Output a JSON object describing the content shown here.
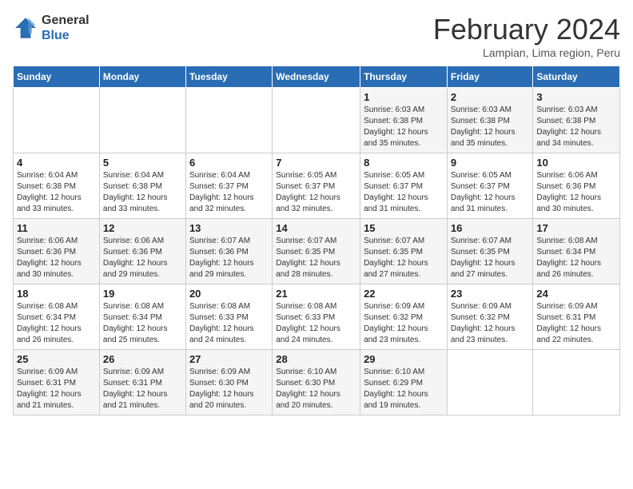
{
  "logo": {
    "line1": "General",
    "line2": "Blue"
  },
  "title": "February 2024",
  "subtitle": "Lampian, Lima region, Peru",
  "days_of_week": [
    "Sunday",
    "Monday",
    "Tuesday",
    "Wednesday",
    "Thursday",
    "Friday",
    "Saturday"
  ],
  "weeks": [
    [
      {
        "day": "",
        "detail": ""
      },
      {
        "day": "",
        "detail": ""
      },
      {
        "day": "",
        "detail": ""
      },
      {
        "day": "",
        "detail": ""
      },
      {
        "day": "1",
        "detail": "Sunrise: 6:03 AM\nSunset: 6:38 PM\nDaylight: 12 hours\nand 35 minutes."
      },
      {
        "day": "2",
        "detail": "Sunrise: 6:03 AM\nSunset: 6:38 PM\nDaylight: 12 hours\nand 35 minutes."
      },
      {
        "day": "3",
        "detail": "Sunrise: 6:03 AM\nSunset: 6:38 PM\nDaylight: 12 hours\nand 34 minutes."
      }
    ],
    [
      {
        "day": "4",
        "detail": "Sunrise: 6:04 AM\nSunset: 6:38 PM\nDaylight: 12 hours\nand 33 minutes."
      },
      {
        "day": "5",
        "detail": "Sunrise: 6:04 AM\nSunset: 6:38 PM\nDaylight: 12 hours\nand 33 minutes."
      },
      {
        "day": "6",
        "detail": "Sunrise: 6:04 AM\nSunset: 6:37 PM\nDaylight: 12 hours\nand 32 minutes."
      },
      {
        "day": "7",
        "detail": "Sunrise: 6:05 AM\nSunset: 6:37 PM\nDaylight: 12 hours\nand 32 minutes."
      },
      {
        "day": "8",
        "detail": "Sunrise: 6:05 AM\nSunset: 6:37 PM\nDaylight: 12 hours\nand 31 minutes."
      },
      {
        "day": "9",
        "detail": "Sunrise: 6:05 AM\nSunset: 6:37 PM\nDaylight: 12 hours\nand 31 minutes."
      },
      {
        "day": "10",
        "detail": "Sunrise: 6:06 AM\nSunset: 6:36 PM\nDaylight: 12 hours\nand 30 minutes."
      }
    ],
    [
      {
        "day": "11",
        "detail": "Sunrise: 6:06 AM\nSunset: 6:36 PM\nDaylight: 12 hours\nand 30 minutes."
      },
      {
        "day": "12",
        "detail": "Sunrise: 6:06 AM\nSunset: 6:36 PM\nDaylight: 12 hours\nand 29 minutes."
      },
      {
        "day": "13",
        "detail": "Sunrise: 6:07 AM\nSunset: 6:36 PM\nDaylight: 12 hours\nand 29 minutes."
      },
      {
        "day": "14",
        "detail": "Sunrise: 6:07 AM\nSunset: 6:35 PM\nDaylight: 12 hours\nand 28 minutes."
      },
      {
        "day": "15",
        "detail": "Sunrise: 6:07 AM\nSunset: 6:35 PM\nDaylight: 12 hours\nand 27 minutes."
      },
      {
        "day": "16",
        "detail": "Sunrise: 6:07 AM\nSunset: 6:35 PM\nDaylight: 12 hours\nand 27 minutes."
      },
      {
        "day": "17",
        "detail": "Sunrise: 6:08 AM\nSunset: 6:34 PM\nDaylight: 12 hours\nand 26 minutes."
      }
    ],
    [
      {
        "day": "18",
        "detail": "Sunrise: 6:08 AM\nSunset: 6:34 PM\nDaylight: 12 hours\nand 26 minutes."
      },
      {
        "day": "19",
        "detail": "Sunrise: 6:08 AM\nSunset: 6:34 PM\nDaylight: 12 hours\nand 25 minutes."
      },
      {
        "day": "20",
        "detail": "Sunrise: 6:08 AM\nSunset: 6:33 PM\nDaylight: 12 hours\nand 24 minutes."
      },
      {
        "day": "21",
        "detail": "Sunrise: 6:08 AM\nSunset: 6:33 PM\nDaylight: 12 hours\nand 24 minutes."
      },
      {
        "day": "22",
        "detail": "Sunrise: 6:09 AM\nSunset: 6:32 PM\nDaylight: 12 hours\nand 23 minutes."
      },
      {
        "day": "23",
        "detail": "Sunrise: 6:09 AM\nSunset: 6:32 PM\nDaylight: 12 hours\nand 23 minutes."
      },
      {
        "day": "24",
        "detail": "Sunrise: 6:09 AM\nSunset: 6:31 PM\nDaylight: 12 hours\nand 22 minutes."
      }
    ],
    [
      {
        "day": "25",
        "detail": "Sunrise: 6:09 AM\nSunset: 6:31 PM\nDaylight: 12 hours\nand 21 minutes."
      },
      {
        "day": "26",
        "detail": "Sunrise: 6:09 AM\nSunset: 6:31 PM\nDaylight: 12 hours\nand 21 minutes."
      },
      {
        "day": "27",
        "detail": "Sunrise: 6:09 AM\nSunset: 6:30 PM\nDaylight: 12 hours\nand 20 minutes."
      },
      {
        "day": "28",
        "detail": "Sunrise: 6:10 AM\nSunset: 6:30 PM\nDaylight: 12 hours\nand 20 minutes."
      },
      {
        "day": "29",
        "detail": "Sunrise: 6:10 AM\nSunset: 6:29 PM\nDaylight: 12 hours\nand 19 minutes."
      },
      {
        "day": "",
        "detail": ""
      },
      {
        "day": "",
        "detail": ""
      }
    ]
  ]
}
